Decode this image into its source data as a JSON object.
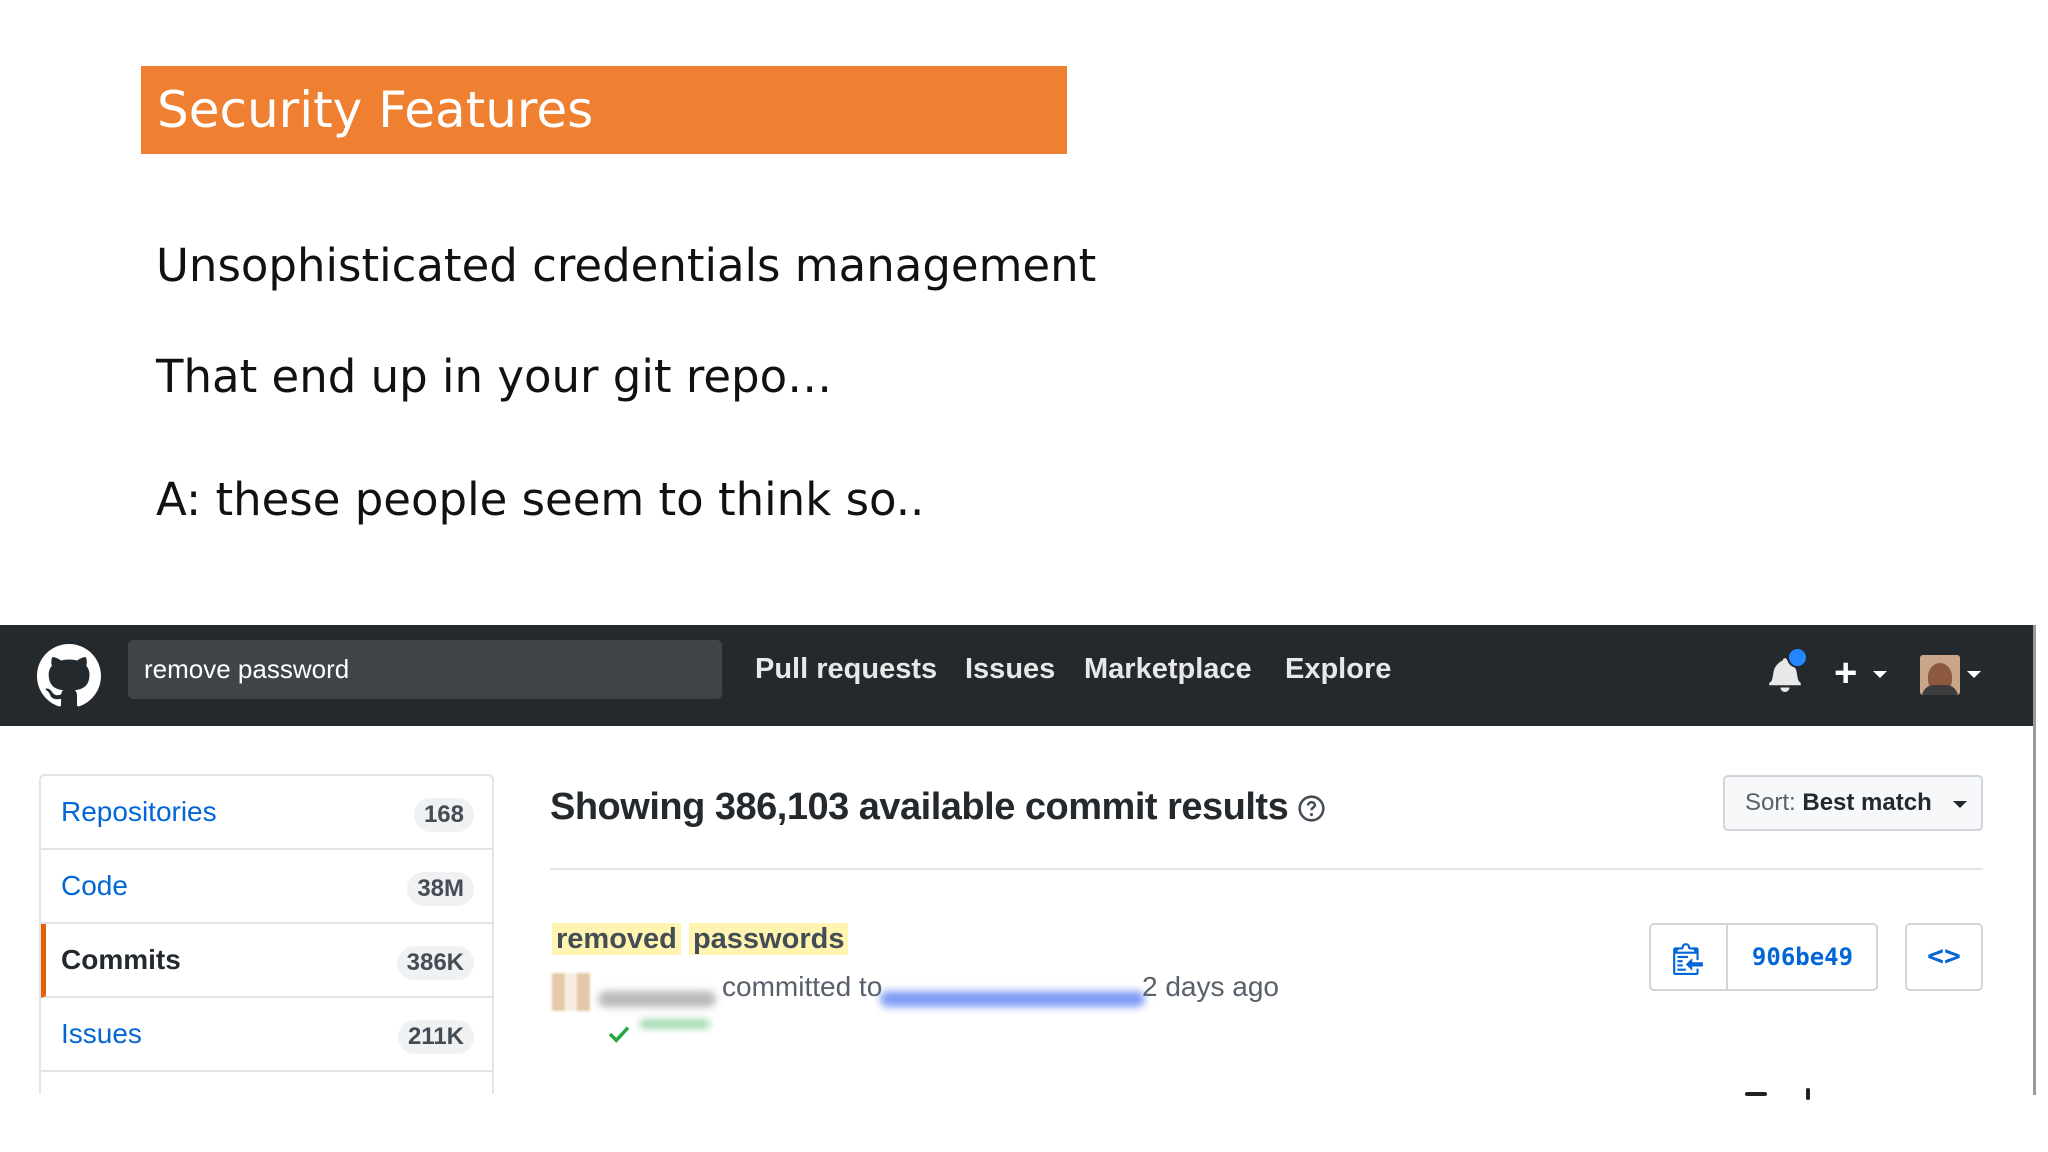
{
  "slide": {
    "title": "Security Features",
    "lines": [
      "Unsophisticated credentials management",
      "That end up in your git repo…",
      "A:  these people seem to think so.."
    ]
  },
  "github": {
    "search": {
      "value": "remove password"
    },
    "nav": [
      "Pull requests",
      "Issues",
      "Marketplace",
      "Explore"
    ],
    "plus_label": "+",
    "menu": [
      {
        "label": "Repositories",
        "count": "168"
      },
      {
        "label": "Code",
        "count": "38M"
      },
      {
        "label": "Commits",
        "count": "386K",
        "selected": true
      },
      {
        "label": "Issues",
        "count": "211K"
      }
    ],
    "results_heading": "Showing 386,103 available commit results",
    "sort": {
      "prefix": "Sort:",
      "value": "Best match"
    },
    "commit": {
      "message_words": [
        "removed",
        "passwords"
      ],
      "committed_text": "committed to",
      "time_ago": "2 days ago",
      "sha": "906be49",
      "browse_label": "<>"
    },
    "colors": {
      "title_bar": "#ef7f31",
      "header_bg": "#24292e",
      "link": "#0366d6",
      "selected_accent": "#e36209",
      "highlight": "#fff5b1"
    },
    "icons": [
      "github-logo-icon",
      "bell-icon",
      "plus-icon",
      "avatar",
      "help-icon",
      "clipboard-icon",
      "check-icon",
      "browse-code-icon"
    ]
  }
}
